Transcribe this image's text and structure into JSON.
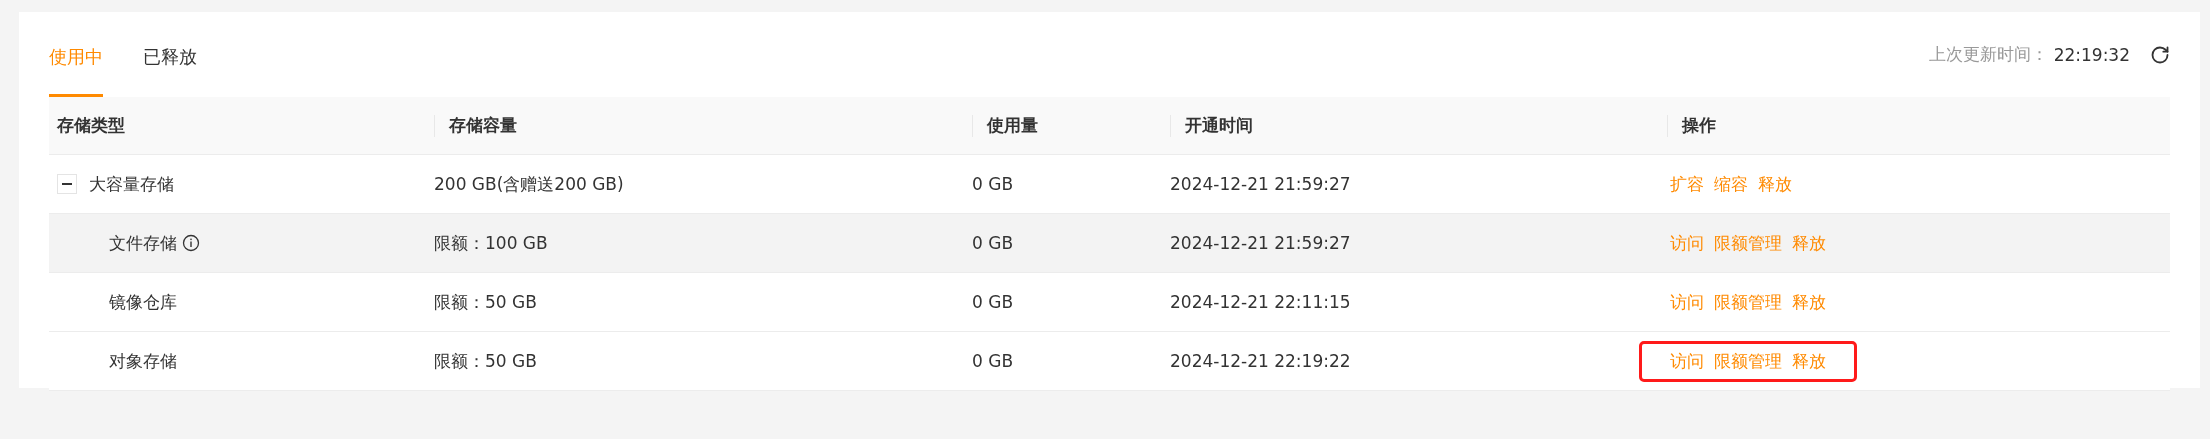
{
  "tabs": [
    {
      "label": "使用中",
      "selected": true
    },
    {
      "label": "已释放",
      "selected": false
    }
  ],
  "last_update": {
    "label": "上次更新时间：",
    "value": "22:19:32"
  },
  "table": {
    "columns": [
      "存储类型",
      "存储容量",
      "使用量",
      "开通时间",
      "操作"
    ],
    "rows": [
      {
        "type": "大容量存储",
        "capacity": "200 GB(含赠送200 GB)",
        "usage": "0 GB",
        "opened": "2024-12-21 21:59:27",
        "expanded": true,
        "highlighted": false,
        "outlined": false,
        "actions": [
          "扩容",
          "缩容",
          "释放"
        ],
        "children": [
          {
            "type": "文件存储",
            "info": true,
            "capacity": "限额：100 GB",
            "usage": "0 GB",
            "opened": "2024-12-21 21:59:27",
            "highlighted": true,
            "outlined": false,
            "actions": [
              "访问",
              "限额管理",
              "释放"
            ]
          },
          {
            "type": "镜像仓库",
            "info": false,
            "capacity": "限额：50 GB",
            "usage": "0 GB",
            "opened": "2024-12-21 22:11:15",
            "highlighted": false,
            "outlined": false,
            "actions": [
              "访问",
              "限额管理",
              "释放"
            ]
          },
          {
            "type": "对象存储",
            "info": false,
            "capacity": "限额：50 GB",
            "usage": "0 GB",
            "opened": "2024-12-21 22:19:22",
            "highlighted": false,
            "outlined": true,
            "actions": [
              "访问",
              "限额管理",
              "释放"
            ]
          }
        ]
      }
    ]
  }
}
